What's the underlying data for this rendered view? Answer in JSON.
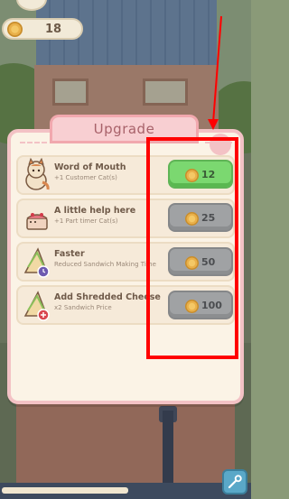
{
  "hud": {
    "coins": "18"
  },
  "modal": {
    "title": "Upgrade",
    "items": [
      {
        "title": "Word of Mouth",
        "desc": "+1 Customer Cat(s)",
        "price": "12",
        "icon": "cat-icon",
        "state": "affordable"
      },
      {
        "title": "A little help here",
        "desc": "+1 Part timer Cat(s)",
        "price": "25",
        "icon": "cake-cat-icon",
        "state": "locked"
      },
      {
        "title": "Faster",
        "desc": "Reduced Sandwich Making Time",
        "price": "50",
        "icon": "sandwich-clock-icon",
        "state": "locked"
      },
      {
        "title": "Add Shredded Cheese",
        "desc": "x2 Sandwich Price",
        "price": "100",
        "icon": "sandwich-plus-icon",
        "state": "locked"
      }
    ]
  },
  "colors": {
    "affordable": "#7bd870",
    "locked": "#a0a2a4",
    "annotation": "#ff0000",
    "modal_border": "#f3c2c5"
  }
}
